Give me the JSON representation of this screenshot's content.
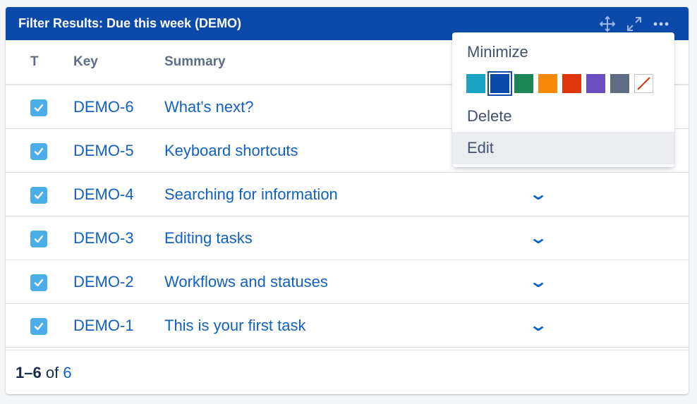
{
  "gadget": {
    "title": "Filter Results: Due this week (DEMO)",
    "header_icons": [
      "move-icon",
      "expand-icon",
      "more-icon"
    ]
  },
  "table": {
    "columns": [
      "T",
      "Key",
      "Summary"
    ],
    "rows": [
      {
        "key": "DEMO-6",
        "summary": "What's next?"
      },
      {
        "key": "DEMO-5",
        "summary": "Keyboard shortcuts"
      },
      {
        "key": "DEMO-4",
        "summary": "Searching for information"
      },
      {
        "key": "DEMO-3",
        "summary": "Editing tasks"
      },
      {
        "key": "DEMO-2",
        "summary": "Workflows and statuses"
      },
      {
        "key": "DEMO-1",
        "summary": "This is your first task"
      }
    ]
  },
  "pagination": {
    "range": "1–6",
    "of": "of",
    "total": "6"
  },
  "menu": {
    "minimize": "Minimize",
    "delete": "Delete",
    "edit": "Edit",
    "colors": [
      "#1aa3c2",
      "#0b4aab",
      "#1c8754",
      "#f68909",
      "#de350b",
      "#6b4fc2",
      "#5e6c84",
      "none"
    ],
    "selected_color": "#0b4aab"
  },
  "colors": {
    "header_bg": "#0b4aab",
    "link": "#1160c4",
    "task_type": "#4bade8"
  }
}
